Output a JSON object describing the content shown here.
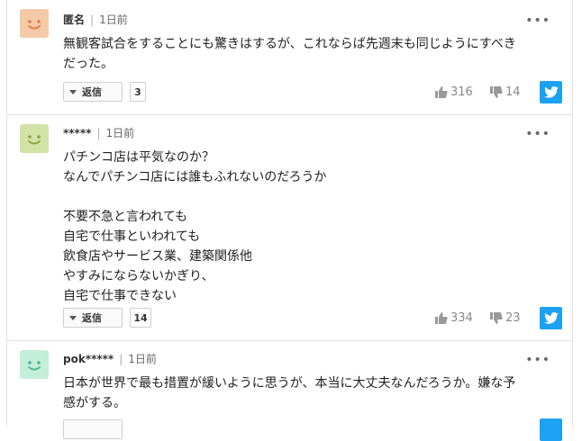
{
  "colors": {
    "avatar_orange": "#f4c9a8",
    "avatar_green": "#d2e3a6",
    "avatar_mint": "#c3eed8",
    "twitter": "#1da1f2"
  },
  "comments": [
    {
      "author": "匿名",
      "separator": "|",
      "time": "1日前",
      "more": "•••",
      "body": "無観客試合をすることにも驚きはするが、これならば先週末も同じようにすべき\nだった。",
      "reply_label": "返信",
      "reply_count": "3",
      "likes": "316",
      "dislikes": "14",
      "share_icon": "twitter-icon",
      "avatar_icon": "smiley-face-icon"
    },
    {
      "author": "*****",
      "separator": "|",
      "time": "1日前",
      "more": "•••",
      "body": "パチンコ店は平気なのか？\nなんでパチンコ店には誰もふれないのだろうか\n\n不要不急と言われても\n自宅で仕事といわれても\n飲食店やサービス業、建築関係他\nやすみにならないかぎり、\n自宅で仕事できない",
      "reply_label": "返信",
      "reply_count": "14",
      "likes": "334",
      "dislikes": "23",
      "share_icon": "twitter-icon",
      "avatar_icon": "smiley-face-icon"
    },
    {
      "author": "pok*****",
      "separator": "|",
      "time": "1日前",
      "more": "•••",
      "body": "日本が世界で最も措置が緩いように思うが、本当に大丈夫なんだろうか。嫌な予\n感がする。",
      "avatar_icon": "smiley-face-icon"
    }
  ]
}
